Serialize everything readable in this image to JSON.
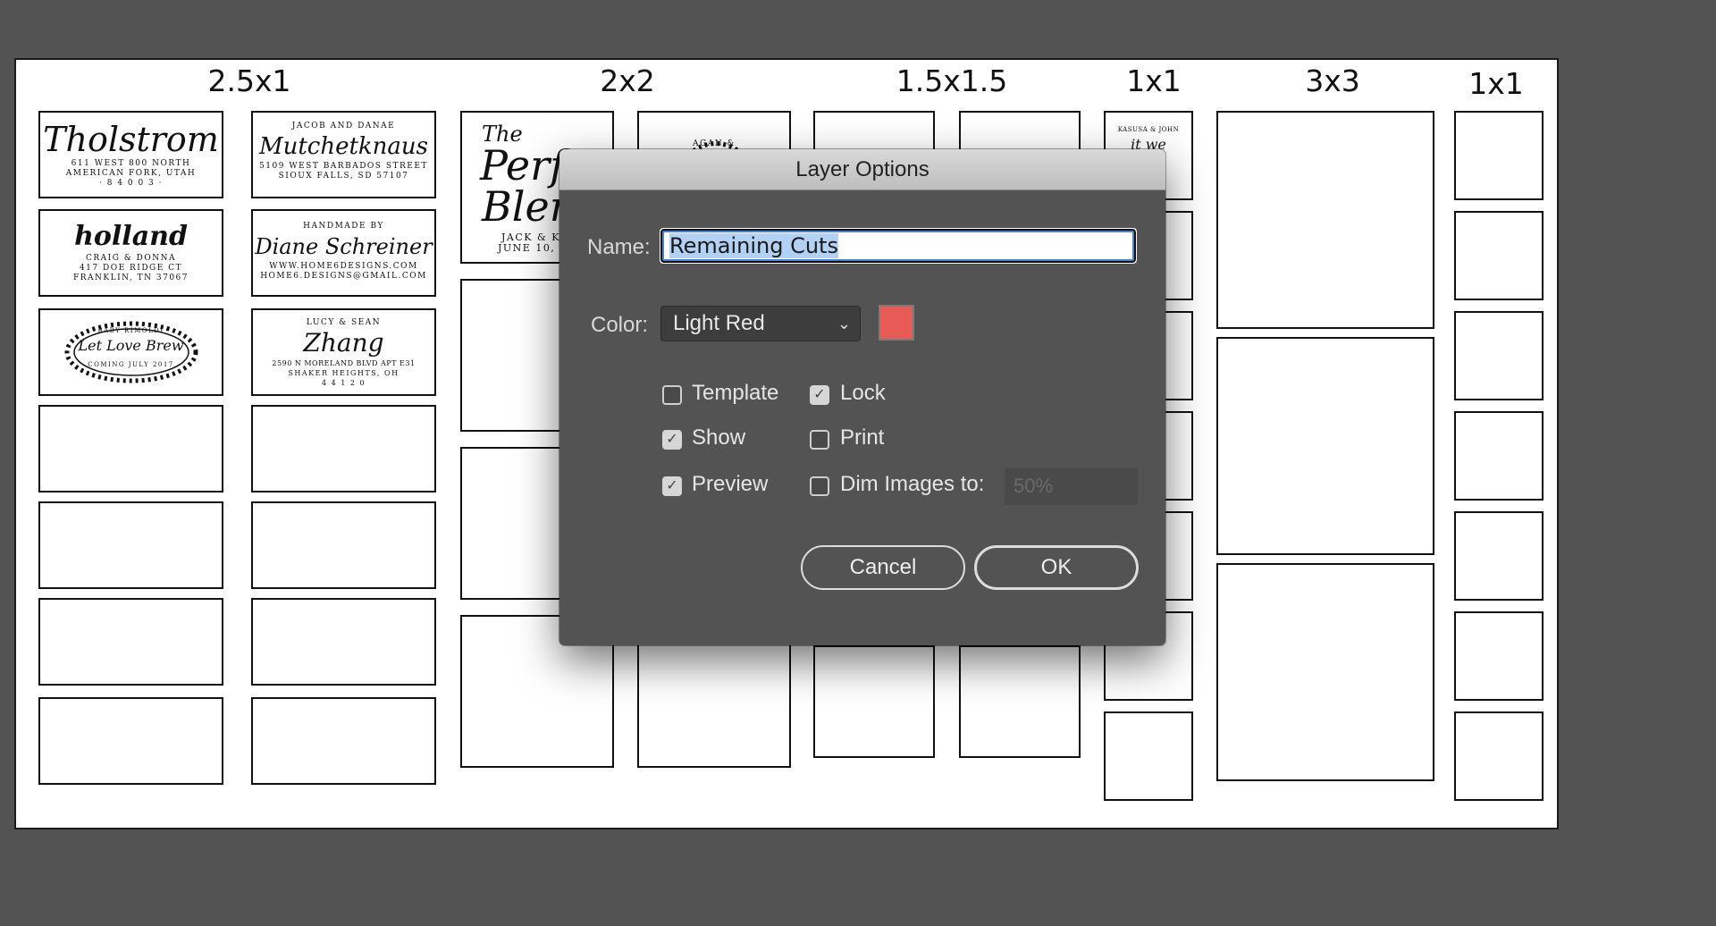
{
  "canvas": {
    "headers": [
      "2.5x1",
      "2x2",
      "1.5x1.5",
      "1x1",
      "3x3",
      "1x1"
    ],
    "stamps": {
      "tholstrom": {
        "name": "Tholstrom",
        "lines": [
          "611 WEST 800 NORTH",
          "AMERICAN FORK, UTAH",
          "· 8 4 0 0 3 ·"
        ]
      },
      "mutchetknaus": {
        "top": "JACOB AND DANAE",
        "name": "Mutchetknaus",
        "lines": [
          "5109 WEST BARBADOS STREET",
          "SIOUX FALLS, SD 57107"
        ]
      },
      "holland": {
        "name": "holland",
        "lines": [
          "CRAIG & DONNA",
          "417 DOE RIDGE CT",
          "FRANKLIN, TN 37067"
        ]
      },
      "schreiner": {
        "top": "HANDMADE BY",
        "name": "Diane Schreiner",
        "lines": [
          "WWW.HOME6DESIGNS.COM",
          "HOME6.DESIGNS@GMAIL.COM"
        ]
      },
      "letlovebrew": {
        "top": "BABY RIMOLDI",
        "name": "Let Love Brew",
        "bottom": "COMING JULY 2017"
      },
      "zhang": {
        "top": "LUCY & SEAN",
        "name": "Zhang",
        "lines": [
          "2590 N MORELAND BLVD APT E31",
          "SHAKER HEIGHTS, OH",
          "4 4 1 2 0"
        ]
      },
      "perfect": {
        "name1": "The",
        "name2": "Perfe",
        "name3": "Blen",
        "lines": [
          "JACK & KA",
          "JUNE 10, 2"
        ]
      },
      "wreath": {
        "text": "AGAN &"
      },
      "round": {
        "text": "KASUSA & JOHN",
        "name": "it we"
      }
    }
  },
  "dialog": {
    "title": "Layer Options",
    "name_label": "Name:",
    "name_value": "Remaining Cuts",
    "color_label": "Color:",
    "color_value": "Light Red",
    "swatch_color": "#e85a56",
    "checkboxes": {
      "template": {
        "label": "Template",
        "checked": false
      },
      "lock": {
        "label": "Lock",
        "checked": true
      },
      "show": {
        "label": "Show",
        "checked": true
      },
      "print": {
        "label": "Print",
        "checked": false
      },
      "preview": {
        "label": "Preview",
        "checked": true
      },
      "dim": {
        "label": "Dim Images to:",
        "checked": false
      }
    },
    "dim_value": "50%",
    "cancel_label": "Cancel",
    "ok_label": "OK"
  }
}
